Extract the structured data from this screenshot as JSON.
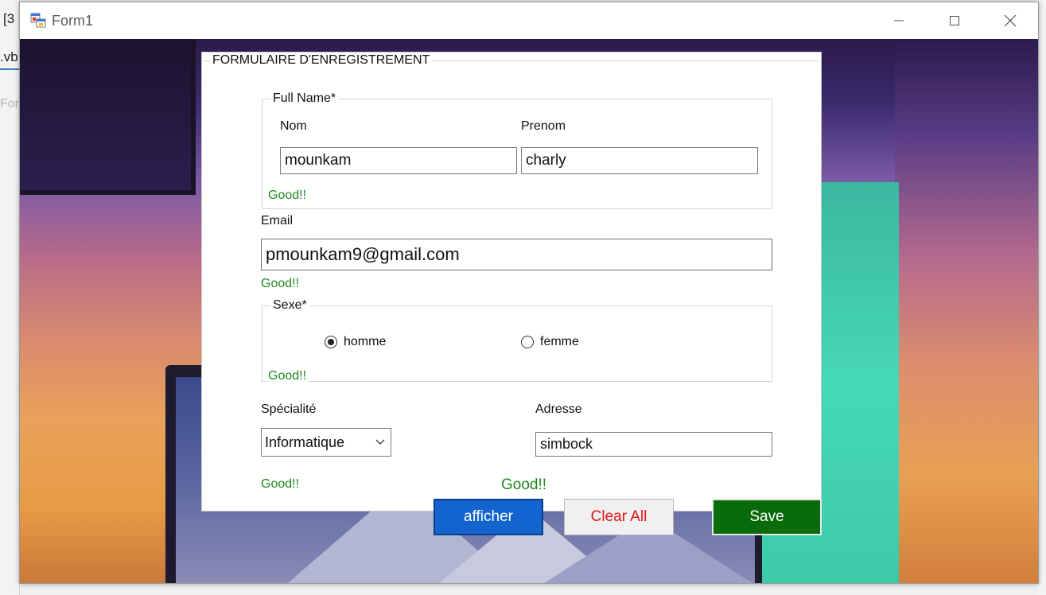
{
  "ide": {
    "left_text_1": "[3",
    "left_text_2": ".vb",
    "left_text_3": "For"
  },
  "window": {
    "title": "Form1",
    "controls": {
      "minimize": "minimize",
      "maximize": "maximize",
      "close": "close"
    }
  },
  "form": {
    "legend": "FORMULAIRE D'ENREGISTREMENT",
    "full_name": {
      "legend": "Full Name*",
      "nom_label": "Nom",
      "prenom_label": "Prenom",
      "nom_value": "mounkam",
      "prenom_value": "charly",
      "status": "Good!!"
    },
    "email": {
      "label": "Email",
      "value": "pmounkam9@gmail.com",
      "status": "Good!!"
    },
    "sexe": {
      "legend": "Sexe*",
      "options": [
        {
          "label": "homme",
          "checked": true
        },
        {
          "label": "femme",
          "checked": false
        }
      ],
      "status": "Good!!"
    },
    "specialite": {
      "label": "Spécialité",
      "selected": "Informatique",
      "status": "Good!!"
    },
    "adresse": {
      "label": "Adresse",
      "value": "simbock",
      "status": "Good!!"
    }
  },
  "buttons": {
    "afficher": "afficher",
    "clear_all": "Clear All",
    "save": "Save"
  },
  "colors": {
    "good": "#1f8a1f",
    "afficher_bg": "#1464d0",
    "clear_text": "#e01515",
    "save_bg": "#0a6b0a"
  }
}
